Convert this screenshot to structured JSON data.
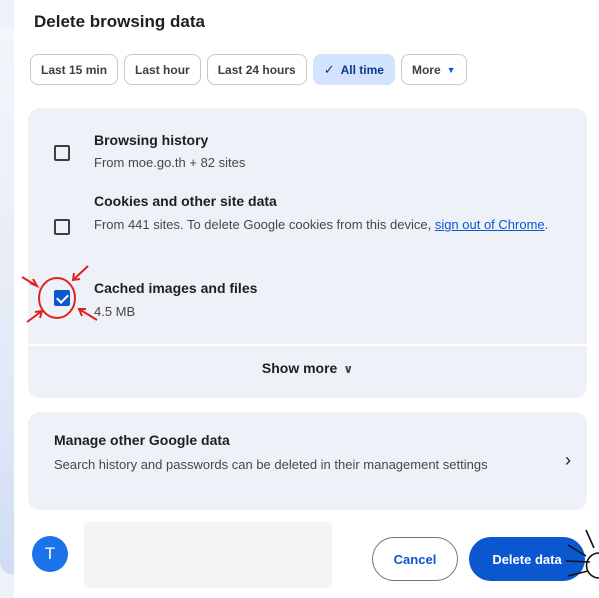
{
  "dialog": {
    "title": "Delete browsing data",
    "time_ranges": [
      {
        "label": "Last 15 min",
        "selected": false
      },
      {
        "label": "Last hour",
        "selected": false
      },
      {
        "label": "Last 24 hours",
        "selected": false
      },
      {
        "label": "All time",
        "selected": true
      },
      {
        "label": "More",
        "selected": false
      }
    ],
    "items": [
      {
        "title": "Browsing history",
        "subtitle": "From moe.go.th + 82 sites",
        "checked": false
      },
      {
        "title": "Cookies and other site data",
        "subtitle_prefix": "From 441 sites. To delete Google cookies from this device, ",
        "subtitle_link": "sign out of Chrome",
        "subtitle_suffix": ".",
        "checked": false
      },
      {
        "title": "Cached images and files",
        "subtitle": "4.5 MB",
        "checked": true
      }
    ],
    "show_more_label": "Show more",
    "manage": {
      "title": "Manage other Google data",
      "subtitle": "Search history and passwords can be deleted in their management settings"
    },
    "profile": {
      "avatar_letter": "T"
    },
    "buttons": {
      "cancel": "Cancel",
      "delete": "Delete data"
    }
  },
  "colors": {
    "accent": "#0b57d0",
    "chip_active": "#d3e3fd",
    "panel": "#eef2f8",
    "annotation": "#e0221e"
  }
}
